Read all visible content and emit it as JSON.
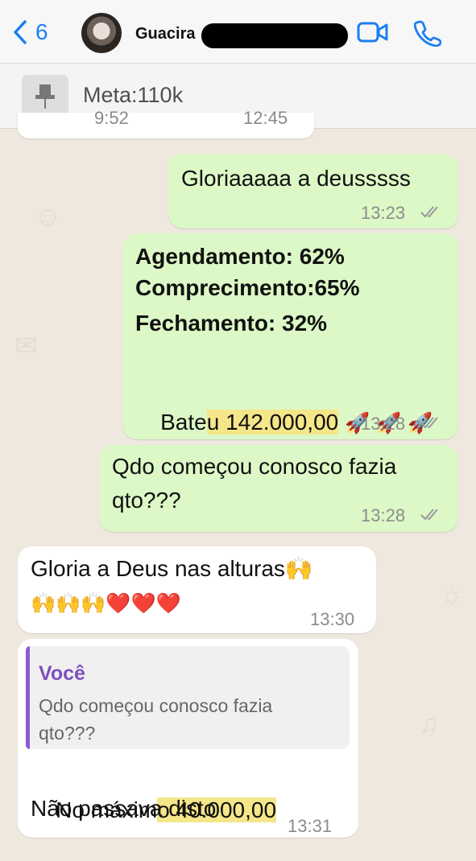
{
  "header": {
    "back_count": "6",
    "contact_name": "Guacira",
    "icons": [
      "chevron-left-icon",
      "video-camera-icon",
      "phone-icon"
    ],
    "accent_color": "#1a7ff0"
  },
  "pinned": {
    "icon": "pin-icon",
    "text": "Meta:110k"
  },
  "previous_message": {
    "time_left": "9:52",
    "time_right": "12:45"
  },
  "messages": [
    {
      "direction": "out",
      "lines": [
        "Gloriaaaaa a deusssss"
      ],
      "time": "13:23"
    },
    {
      "direction": "out",
      "bold_lines": [
        "Agendamento: 62%",
        "Comprecimento:65%",
        "Fechamento: 32%"
      ],
      "prefix": "Bate",
      "highlight": "u 142.000,00",
      "emoji": "🚀 🚀 🚀",
      "time": "13:28"
    },
    {
      "direction": "out",
      "lines": [
        "Qdo começou conosco fazia",
        "qto???"
      ],
      "time": "13:28"
    },
    {
      "direction": "in",
      "line1": "Gloria a Deus nas alturas🙌",
      "line2": "🙌🙌🙌❤️❤️❤️",
      "time": "13:30"
    },
    {
      "direction": "in",
      "quote_author": "Você",
      "quote_text": "Qdo começou conosco fazia\nqto???",
      "line1_prefix": "No máxim",
      "line1_highlight": "o 40.000,00",
      "line2": "Não passava disto",
      "time": "13:31"
    }
  ],
  "colors": {
    "chat_bg": "#efe8df",
    "outgoing_bubble": "#dcf8c6",
    "incoming_bubble": "#ffffff",
    "highlight": "#f5e68a",
    "quote_accent": "#8a5ad8"
  }
}
